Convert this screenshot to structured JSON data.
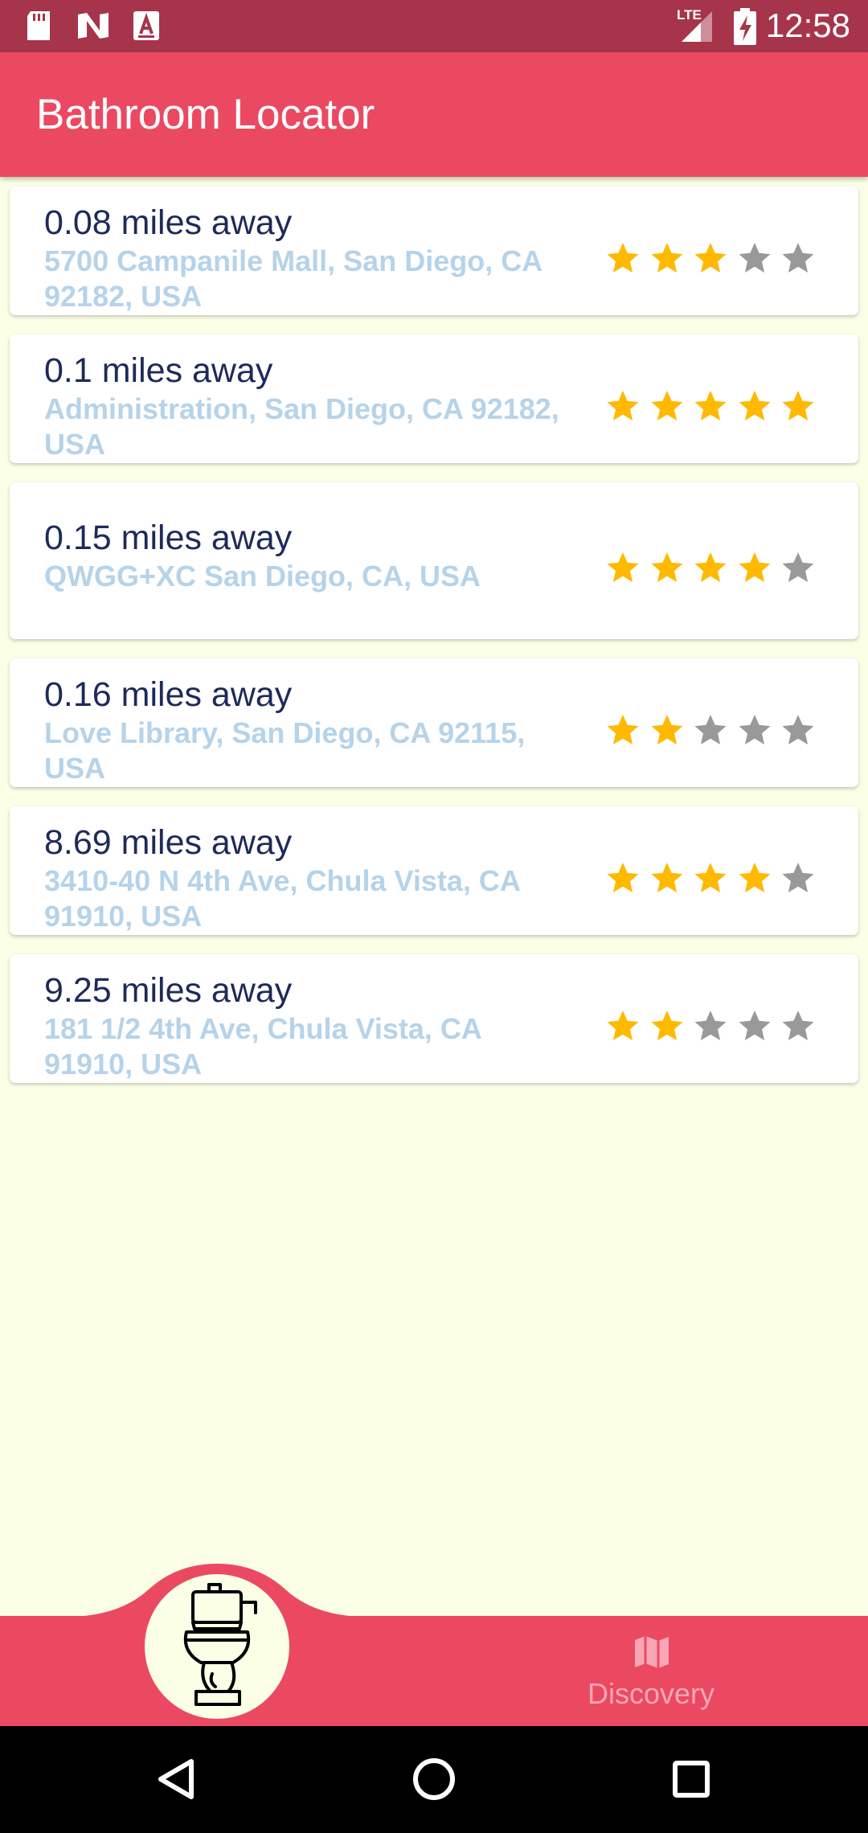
{
  "status_bar": {
    "time": "12:58",
    "network_label": "LTE",
    "icons": [
      "sd-card-icon",
      "n-notification-icon",
      "a-notification-icon",
      "lte-signal-icon",
      "battery-charging-icon"
    ]
  },
  "app_bar": {
    "title": "Bathroom Locator"
  },
  "colors": {
    "primary": "#EB4962",
    "primary_dark": "#A6344B",
    "background": "#FAFFE6",
    "distance_text": "#1E2A5A",
    "address_text": "#B5D3EA",
    "star_filled": "#FFB900",
    "star_empty": "#999999"
  },
  "bathrooms": [
    {
      "distance": "0.08 miles away",
      "address": "5700 Campanile Mall, San Diego, CA 92182, USA",
      "rating": 3,
      "max_rating": 5
    },
    {
      "distance": "0.1 miles away",
      "address": "Administration, San Diego, CA 92182, USA",
      "rating": 5,
      "max_rating": 5
    },
    {
      "distance": "0.15 miles away",
      "address": "QWGG+XC San Diego, CA, USA",
      "rating": 4,
      "max_rating": 5
    },
    {
      "distance": "0.16 miles away",
      "address": "Love Library, San Diego, CA 92115, USA",
      "rating": 2,
      "max_rating": 5
    },
    {
      "distance": "8.69 miles away",
      "address": "3410-40 N 4th Ave, Chula Vista, CA 91910, USA",
      "rating": 4,
      "max_rating": 5
    },
    {
      "distance": "9.25 miles away",
      "address": "181 1/2 4th Ave, Chula Vista, CA 91910, USA",
      "rating": 2,
      "max_rating": 5
    }
  ],
  "bottom_nav": {
    "center_icon": "toilet-icon",
    "items": [
      {
        "label": "Discovery",
        "icon": "map-icon"
      }
    ]
  },
  "system_nav": {
    "icons": [
      "back-icon",
      "home-icon",
      "recents-icon"
    ]
  }
}
